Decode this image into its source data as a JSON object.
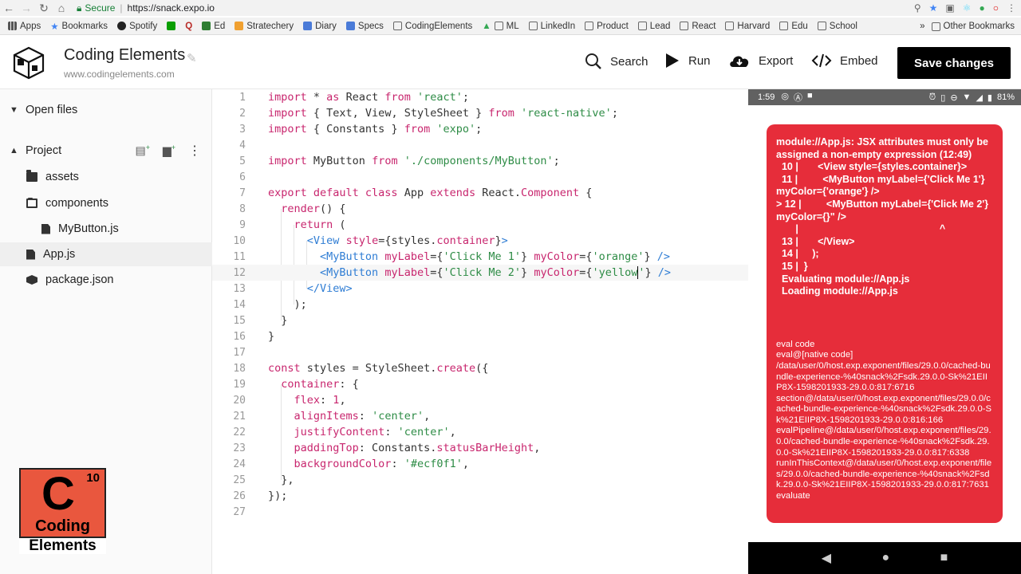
{
  "browser": {
    "secure_label": "Secure",
    "url": "https://snack.expo.io"
  },
  "bookmarks": {
    "items": [
      "Apps",
      "Bookmarks",
      "Spotify",
      "Ed",
      "Stratechery",
      "Diary",
      "Specs",
      "CodingElements",
      "ML",
      "LinkedIn",
      "Product",
      "Lead",
      "React",
      "Harvard",
      "Edu",
      "School"
    ],
    "more": "»",
    "other": "Other Bookmarks"
  },
  "header": {
    "title": "Coding Elements",
    "url": "www.codingelements.com",
    "search": "Search",
    "run": "Run",
    "export": "Export",
    "embed": "Embed",
    "save": "Save changes"
  },
  "sidebar": {
    "open_files": "Open files",
    "project": "Project",
    "items": [
      {
        "label": "assets"
      },
      {
        "label": "components"
      },
      {
        "label": "MyButton.js"
      },
      {
        "label": "App.js"
      },
      {
        "label": "package.json"
      }
    ]
  },
  "brand_badge": {
    "letter": "C",
    "number": "10",
    "word1": "Coding",
    "word2": "Elements"
  },
  "editor": {
    "line_numbers": [
      "1",
      "2",
      "3",
      "4",
      "5",
      "6",
      "7",
      "8",
      "9",
      "10",
      "11",
      "12",
      "13",
      "14",
      "15",
      "16",
      "17",
      "18",
      "19",
      "20",
      "21",
      "22",
      "23",
      "24",
      "25",
      "26",
      "27"
    ]
  },
  "phone": {
    "time": "1:59",
    "battery": "81%",
    "error_message": "module://App.js: JSX attributes must only be assigned a non-empty expression (12:49)\n  10 |       <View style={styles.container}>\n  11 |         <MyButton myLabel={'Click Me 1'} myColor={'orange'} />\n> 12 |         <MyButton myLabel={'Click Me 2'} myColor={}\" />\n       |                                                   ^\n  13 |       </View>\n  14 |     );\n  15 |  }\n  Evaluating module://App.js\n  Loading module://App.js",
    "stack": "eval code\neval@[native code]\n/data/user/0/host.exp.exponent/files/29.0.0/cached-bundle-experience-%40snack%2Fsdk.29.0.0-Sk%21EIIP8X-1598201933-29.0.0:817:6716\nsection@/data/user/0/host.exp.exponent/files/29.0.0/cached-bundle-experience-%40snack%2Fsdk.29.0.0-Sk%21EIIP8X-1598201933-29.0.0:816:166\nevalPipeline@/data/user/0/host.exp.exponent/files/29.0.0/cached-bundle-experience-%40snack%2Fsdk.29.0.0-Sk%21EIIP8X-1598201933-29.0.0:817:6338\nrunInThisContext@/data/user/0/host.exp.exponent/files/29.0.0/cached-bundle-experience-%40snack%2Fsdk.29.0.0-Sk%21EIIP8X-1598201933-29.0.0:817:7631\nevaluate"
  },
  "colors": {
    "error_bg": "#e62d3a",
    "badge": "#e9573e",
    "keyword": "#c8266e",
    "string": "#2e8c46",
    "tag": "#2f7dd4"
  }
}
